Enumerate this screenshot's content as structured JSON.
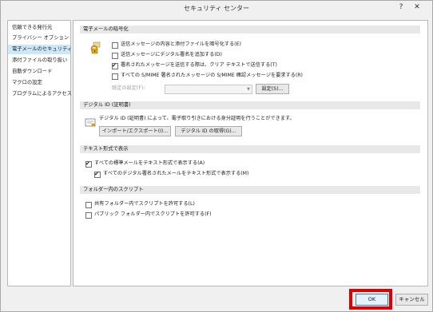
{
  "window": {
    "title": "セキュリティ センター",
    "help_label": "?",
    "close_label": "✕"
  },
  "sidebar": {
    "items": [
      {
        "label": "信頼できる発行元",
        "selected": false
      },
      {
        "label": "プライバシー オプション",
        "selected": false
      },
      {
        "label": "電子メールのセキュリティ",
        "selected": true
      },
      {
        "label": "添付ファイルの取り扱い",
        "selected": false
      },
      {
        "label": "自動ダウンロード",
        "selected": false
      },
      {
        "label": "マクロの設定",
        "selected": false
      },
      {
        "label": "プログラムによるアクセス",
        "selected": false
      }
    ]
  },
  "encryption": {
    "header": "電子メールの暗号化",
    "options": [
      {
        "label": "送信メッセージの内容と添付ファイルを暗号化する(E)",
        "checked": false
      },
      {
        "label": "送信メッセージにデジタル署名を追加する(D)",
        "checked": false
      },
      {
        "label": "署名されたメッセージを送信する際は、クリア テキストで送信する(T)",
        "checked": true
      },
      {
        "label": "すべての S/MIME 署名されたメッセージの S/MIME 確認メッセージを要求する(R)",
        "checked": false
      }
    ],
    "default_setting_label": "既定の設定(F):",
    "default_setting_value": "",
    "settings_button": "設定(S)..."
  },
  "digital_id": {
    "header": "デジタル ID (証明書)",
    "description": "デジタル ID (証明書) によって、電子取り引きにおける身分証明を行うことができます。",
    "import_export_button": "インポート/エクスポート(I)...",
    "get_id_button": "デジタル ID の取得(G)..."
  },
  "plain_text": {
    "header": "テキスト形式で表示",
    "options": [
      {
        "label": "すべての標準メールをテキスト形式で表示する(A)",
        "checked": true
      },
      {
        "label": "すべてのデジタル署名されたメールをテキスト形式で表示する(M)",
        "checked": true
      }
    ]
  },
  "folder_script": {
    "header": "フォルダー内のスクリプト",
    "options": [
      {
        "label": "共有フォルダー内でスクリプトを許可する(L)",
        "checked": false
      },
      {
        "label": "パブリック フォルダー内でスクリプトを許可する(F)",
        "checked": false
      }
    ]
  },
  "footer": {
    "ok_label": "OK",
    "cancel_label": "キャンセル"
  },
  "colors": {
    "selected_item_bg": "#cde8fb",
    "highlight_border": "#e00000",
    "section_header_bg": "#e8e8e8"
  }
}
